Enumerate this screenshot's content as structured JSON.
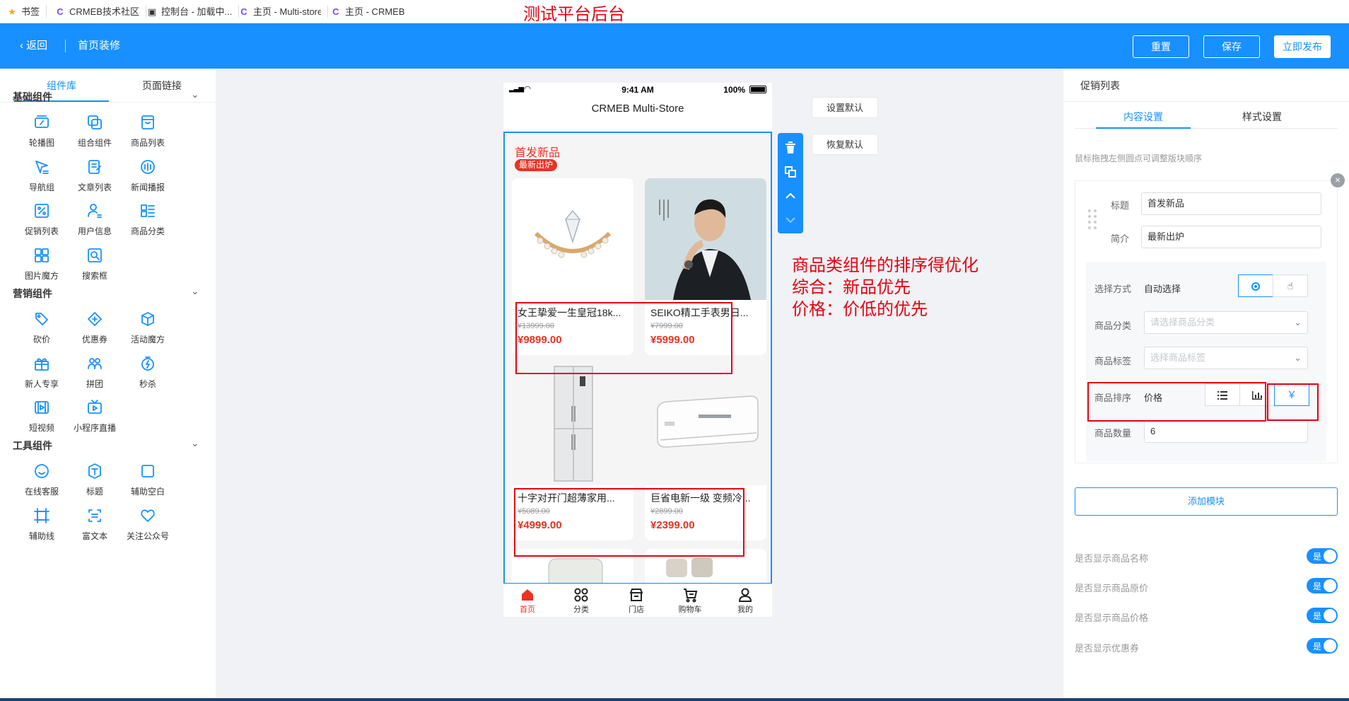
{
  "browser": {
    "bookmarks": [
      {
        "icon": "★",
        "label": "书签"
      },
      {
        "icon": "C",
        "label": "CRMEB技术社区"
      },
      {
        "icon": "▣",
        "label": "控制台 - 加载中..."
      },
      {
        "icon": "C",
        "label": "主页 - Multi-store"
      },
      {
        "icon": "C",
        "label": "主页 - CRMEB"
      }
    ]
  },
  "annotation_top": "测试平台后台",
  "header": {
    "back_label": "返回",
    "page_title": "首页装修",
    "reset_label": "重置",
    "save_label": "保存",
    "publish_label": "立即发布",
    "color": "#1890ff"
  },
  "left": {
    "tabs": [
      "组件库",
      "页面链接"
    ],
    "groups": [
      {
        "title": "基础组件",
        "items": [
          "轮播图",
          "组合组件",
          "商品列表",
          "导航组",
          "文章列表",
          "新闻播报",
          "促销列表",
          "用户信息",
          "商品分类",
          "图片魔方",
          "搜索框"
        ]
      },
      {
        "title": "营销组件",
        "items": [
          "砍价",
          "优惠券",
          "活动魔方",
          "新人专享",
          "拼团",
          "秒杀",
          "短视频",
          "小程序直播"
        ]
      },
      {
        "title": "工具组件",
        "items": [
          "在线客服",
          "标题",
          "辅助空白",
          "辅助线",
          "富文本",
          "关注公众号"
        ]
      }
    ]
  },
  "phone": {
    "time": "9:41 AM",
    "battery": "100%",
    "store_title": "CRMEB Multi-Store",
    "module_title": "首发新品",
    "module_badge": "最新出炉",
    "products": [
      {
        "name": "女王挚爱一生皇冠18k...",
        "orig": "¥13999.00",
        "price": "¥9899.00"
      },
      {
        "name": "SEIKO精工手表男日...",
        "orig": "¥7999.00",
        "price": "¥5999.00"
      },
      {
        "name": "十字对开门超薄家用...",
        "orig": "¥5089.00",
        "price": "¥4999.00"
      },
      {
        "name": "巨省电新一级 变频冷...",
        "orig": "¥2899.00",
        "price": "¥2399.00"
      }
    ],
    "tabbar": [
      "首页",
      "分类",
      "门店",
      "购物车",
      "我的"
    ],
    "accent": "#e93323"
  },
  "side_buttons": {
    "set_default": "设置默认",
    "restore_default": "恢复默认"
  },
  "annotation_mid": [
    "商品类组件的排序得优化",
    "综合：新品优先",
    "价格：价低的优先"
  ],
  "right": {
    "title": "促销列表",
    "tabs": [
      "内容设置",
      "样式设置"
    ],
    "hint": "鼠标拖拽左侧圆点可调整版块顺序",
    "fields": {
      "title_label": "标题",
      "title_value": "首发新品",
      "intro_label": "简介",
      "intro_value": "最新出炉",
      "select_mode_label": "选择方式",
      "select_mode_value": "自动选择",
      "category_label": "商品分类",
      "category_placeholder": "请选择商品分类",
      "tag_label": "商品标签",
      "tag_placeholder": "选择商品标签",
      "sort_label": "商品排序",
      "sort_value": "价格",
      "count_label": "商品数量",
      "count_value": "6"
    },
    "add_module": "添加模块",
    "toggles": [
      {
        "label": "是否显示商品名称",
        "state": "是"
      },
      {
        "label": "是否显示商品原价",
        "state": "是"
      },
      {
        "label": "是否显示商品价格",
        "state": "是"
      },
      {
        "label": "是否显示优惠券",
        "state": "是"
      }
    ]
  }
}
